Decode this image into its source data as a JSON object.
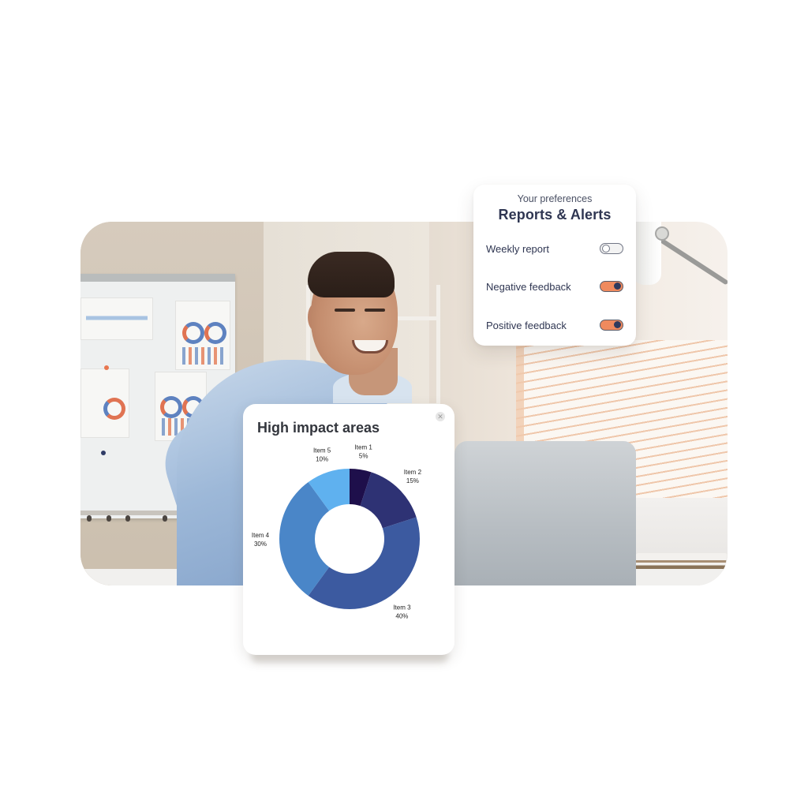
{
  "preferences": {
    "subtitle": "Your preferences",
    "title": "Reports & Alerts",
    "items": [
      {
        "label": "Weekly report",
        "enabled": false
      },
      {
        "label": "Negative feedback",
        "enabled": true
      },
      {
        "label": "Positive feedback",
        "enabled": true
      }
    ],
    "colors": {
      "toggle_on": "#ef8a5e",
      "knob_on": "#2f3a5e",
      "text": "#2f3652"
    }
  },
  "chart_card": {
    "title": "High impact areas",
    "close_icon": "close-icon"
  },
  "photo": {
    "description": "smiling man in light blue shirt at laptop in office with whiteboard of charts"
  },
  "chart_data": {
    "type": "pie",
    "variant": "donut",
    "title": "High impact areas",
    "categories": [
      "Item 1",
      "Item 2",
      "Item 3",
      "Item 4",
      "Item 5"
    ],
    "values": [
      5,
      15,
      40,
      30,
      10
    ],
    "value_labels": [
      "5%",
      "15%",
      "40%",
      "30%",
      "10%"
    ],
    "colors": [
      "#1e0f4b",
      "#2e3274",
      "#3c5aa0",
      "#4a86c8",
      "#5fb1ef"
    ],
    "start_angle": "12 o'clock",
    "direction": "clockwise",
    "legend": "none"
  }
}
